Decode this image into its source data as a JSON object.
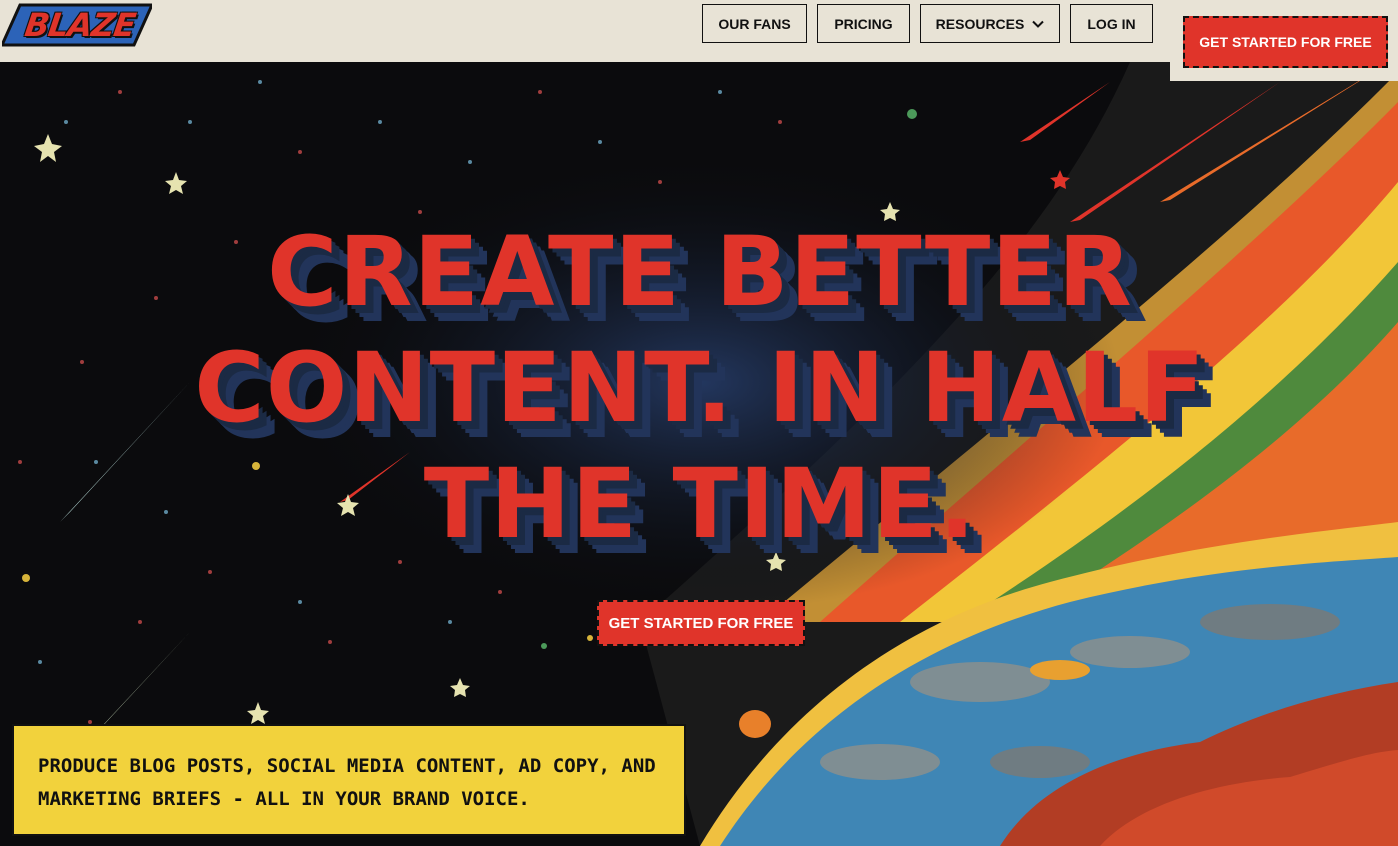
{
  "brand": {
    "logo_text": "BLAZE"
  },
  "nav": {
    "items": [
      {
        "label": "OUR FANS"
      },
      {
        "label": "PRICING"
      },
      {
        "label": "RESOURCES",
        "has_dropdown": true,
        "icon": "chevron-down-icon"
      },
      {
        "label": "LOG IN"
      }
    ],
    "cta_label": "GET STARTED FOR FREE"
  },
  "hero": {
    "headline_lines": [
      "CREATE BETTER",
      "CONTENT. IN HALF",
      "THE TIME."
    ],
    "cta_label": "GET STARTED FOR FREE",
    "callout": "Produce blog posts, social media content, ad copy, and marketing briefs - all in your brand voice."
  },
  "colors": {
    "accent_red": "#e0342a",
    "header_bg": "#e8e3d6",
    "callout_yellow": "#f2d23c",
    "space_bg": "#0b0b0d",
    "headline_shadow": "#1b2a44"
  }
}
